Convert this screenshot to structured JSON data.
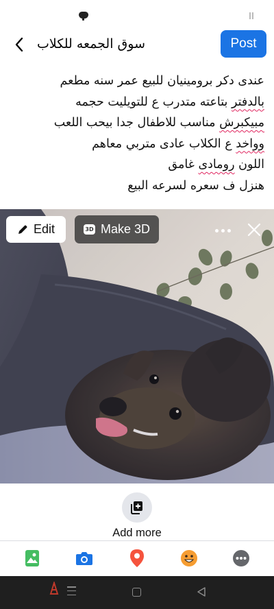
{
  "header": {
    "title": "سوق الجمعه للكلاب",
    "post_label": "Post"
  },
  "post": {
    "lines": [
      [
        "عندى دكر برومينيان للبيع عمر سنه مطعم"
      ],
      [
        "بالدفتر",
        " بتاعته متدرب ع للتويليت حجمه"
      ],
      [
        "مبيكبرش",
        " مناسب للاطفال جدا بيحب اللعب"
      ],
      [
        "وواخد",
        " ع الكلاب عادى متربي معاهم"
      ],
      [
        "اللون ",
        "رومادى",
        " غامق"
      ],
      [
        "هنزل ف سعره لسرعه البيع"
      ]
    ]
  },
  "photo_overlay": {
    "edit_label": "Edit",
    "make3d_label": "Make 3D",
    "badge_text": "3D"
  },
  "add_more": {
    "label": "Add more"
  },
  "colors": {
    "accent": "#1b74e4",
    "spellcheck_underline": "#e0245e",
    "photo_green": "#45bd62",
    "camera_blue": "#1b74e4",
    "location_red": "#f5533d",
    "feeling_orange": "#f7b928",
    "more_gray": "#65676b"
  },
  "icons": {
    "back": "chevron-left-icon",
    "edit": "pencil-icon",
    "make3d": "3d-badge-icon",
    "more": "ellipsis-icon",
    "close": "close-icon",
    "add_more": "add-media-icon",
    "toolbar": [
      "photo-icon",
      "camera-icon",
      "location-pin-icon",
      "smiley-icon",
      "more-icon"
    ],
    "nav": [
      "menu-icon",
      "home-icon",
      "back-triangle-icon"
    ]
  }
}
